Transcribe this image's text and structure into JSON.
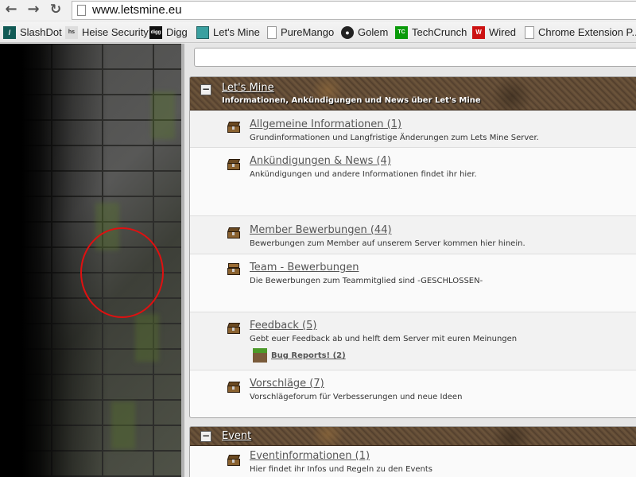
{
  "browser": {
    "url": "www.letsmine.eu",
    "back_icon": "←",
    "forward_icon": "→",
    "reload_icon": "↻",
    "bookmarks": [
      {
        "label": "SlashDot",
        "icon": "slashdot-icon",
        "color": "#115a55"
      },
      {
        "label": "Heise Security",
        "icon": "heise-icon",
        "color": "#333333"
      },
      {
        "label": "Digg",
        "icon": "digg-icon",
        "color": "#111111"
      },
      {
        "label": "Let's Mine",
        "icon": "cube-icon",
        "color": "#3aa0a0"
      },
      {
        "label": "PureMango",
        "icon": "page-icon",
        "color": "#ffffff"
      },
      {
        "label": "Golem",
        "icon": "golem-icon",
        "color": "#222222"
      },
      {
        "label": "TechCrunch",
        "icon": "techcrunch-icon",
        "color": "#0a9a0a"
      },
      {
        "label": "Wired",
        "icon": "wired-icon",
        "color": "#cc1111"
      },
      {
        "label": "Chrome Extension P...",
        "icon": "page-icon",
        "color": "#ffffff"
      }
    ]
  },
  "categories": [
    {
      "toggle": "−",
      "title": "Let's Mine",
      "description": "Informationen, Ankündigungen und News über Let's Mine",
      "forums": [
        {
          "title": "Allgemeine Informationen (1)",
          "desc": "Grundinformationen und Langfristige Änderungen zum Lets Mine Server."
        },
        {
          "title": "Ankündigungen & News (4)",
          "desc": "Ankündigungen und andere Informationen findet ihr hier."
        },
        {
          "title": "Member Bewerbungen (44)",
          "desc": "Bewerbungen zum Member auf unserem Server kommen hier hinein."
        },
        {
          "title": "Team - Bewerbungen",
          "desc": "Die Bewerbungen zum Teammitglied sind -GESCHLOSSEN-"
        },
        {
          "title": "Feedback (5)",
          "desc": "Gebt euer Feedback ab und helft dem Server mit euren Meinungen",
          "subforum": "Bug Reports! (2)"
        },
        {
          "title": "Vorschläge (7)",
          "desc": "Vorschlägeforum für Verbesserungen und neue Ideen"
        }
      ]
    },
    {
      "toggle": "−",
      "title": "Event",
      "forums": [
        {
          "title": "Eventinformationen (1)",
          "desc": "Hier findet ihr Infos und Regeln zu den Events"
        }
      ]
    }
  ]
}
